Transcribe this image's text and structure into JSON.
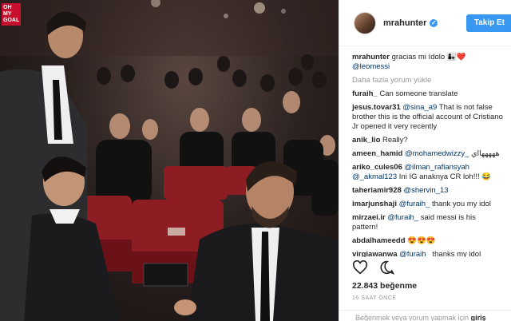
{
  "photo": {
    "watermark_line1": "OH",
    "watermark_line2": "MY",
    "watermark_line3": "GOAL"
  },
  "post": {
    "username": "mrahunter",
    "follow_label": "Takip Et",
    "caption_user": "mrahunter",
    "caption_text": "gracias mi ídolo 👩‍👧❤️",
    "caption_mention": "@leomessi",
    "load_more": "Daha fazla yorum yükle",
    "likes": "22.843 beğenme",
    "time": "16 SAAT ÖNCE",
    "login_prompt": "Beğenmek veya yorum yapmak için",
    "login_link": "giriş"
  },
  "comments": [
    {
      "user": "furaih_",
      "mention": "",
      "text": "Can someone translate"
    },
    {
      "user": "jesus.tovar31",
      "mention": "@sina_a9",
      "text": "That is not false brother this is the official account of Cristiano Jr opened it very recently"
    },
    {
      "user": "anik_lio",
      "mention": "",
      "text": "Really?"
    },
    {
      "user": "ameen_hamid",
      "mention": "@mohamedwizzy_",
      "text": "هههههااي"
    },
    {
      "user": "ariko_cules06",
      "mention": "@ilman_rafiansyah @_akmal123",
      "text": "Ini IG anaknya CR loh!!! 😂"
    },
    {
      "user": "taheriamir928",
      "mention": "@shervin_13",
      "text": ""
    },
    {
      "user": "imarjunshaji",
      "mention": "@furaih_",
      "text": "thank you my idol"
    },
    {
      "user": "mirzaei.ir",
      "mention": "@furaih_",
      "text": "said messi is his pattern!"
    },
    {
      "user": "abdalhameedd",
      "mention": "",
      "text": "😍😍😍"
    },
    {
      "user": "virgiawanwa",
      "mention": "@furaih_",
      "text": "thanks my idol"
    }
  ],
  "icons": {
    "like": "heart-icon",
    "comment": "comment-bubble-icon",
    "verified": "verified-badge-icon"
  }
}
